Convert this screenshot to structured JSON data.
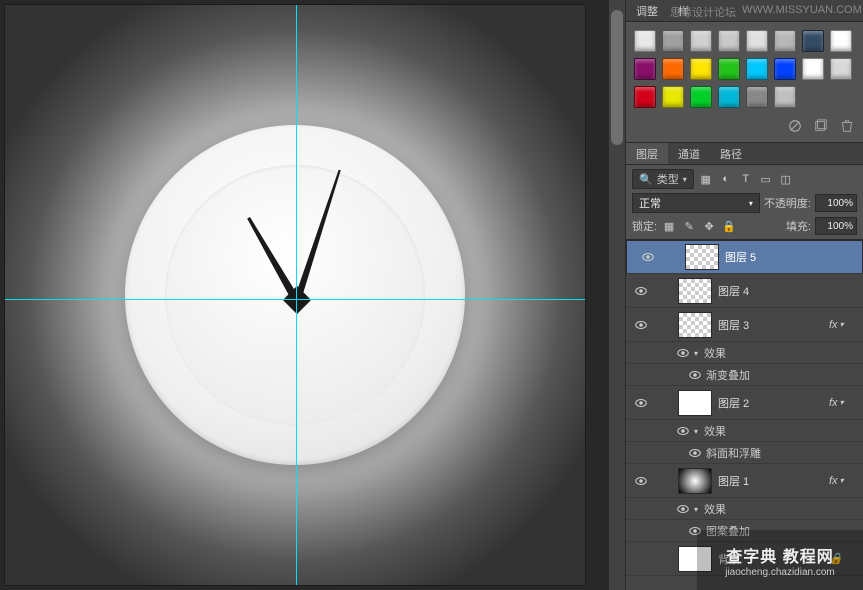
{
  "topWatermark": {
    "text": "思缘设计论坛",
    "url": "WWW.MISSYUAN.COM"
  },
  "tabs": {
    "adjust": "调整",
    "styles": "样",
    "layers": "图层",
    "channels": "通道",
    "paths": "路径"
  },
  "swatches": {
    "row1": [
      "#e8e8e8",
      "#a0a0a0",
      "#d0d0d0",
      "#c8c8c8",
      "#e0e0e0",
      "#b8b8b8",
      "#344b66",
      "#ffffff"
    ],
    "row2": [
      "#8a0e6a",
      "#ff6a00",
      "#ffe400",
      "#22c41a",
      "#00c8ff",
      "#0042ff",
      "#ffffff",
      "#d8d8d8"
    ],
    "row3": [
      "#d4001a",
      "#e8e800",
      "#00d028",
      "#00b8d8",
      "#888888",
      "#c0c0c0"
    ]
  },
  "filter": {
    "label": "类型"
  },
  "blend": {
    "mode": "正常",
    "opacityLabel": "不透明度:",
    "opacity": "100%",
    "fillLabel": "填充:",
    "fill": "100%",
    "lockLabel": "锁定:"
  },
  "layers": [
    {
      "name": "图层 5",
      "sel": true,
      "thumb": "chk"
    },
    {
      "name": "图层 4",
      "thumb": "chk"
    },
    {
      "name": "图层 3",
      "thumb": "chk",
      "fx": true,
      "effects": [
        "效果",
        "渐变叠加"
      ]
    },
    {
      "name": "图层 2",
      "thumb": "white",
      "fx": true,
      "effects": [
        "效果",
        "斜面和浮雕"
      ]
    },
    {
      "name": "图层 1",
      "thumb": "grad",
      "fx": true,
      "effects": [
        "效果",
        "图案叠加"
      ]
    },
    {
      "name": "背景",
      "thumb": "white",
      "locked": true,
      "vis": false
    }
  ],
  "watermark": {
    "main": "查字典 教程网",
    "sub": "jiaocheng.chazidian.com"
  }
}
